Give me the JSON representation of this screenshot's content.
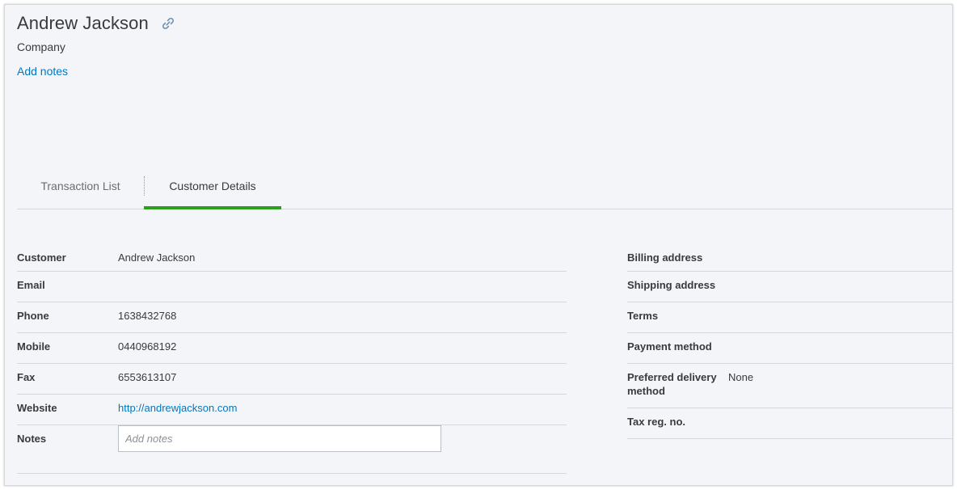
{
  "header": {
    "name": "Andrew Jackson",
    "subtitle": "Company",
    "add_notes": "Add notes",
    "link_icon": "link-icon"
  },
  "tabs": [
    {
      "label": "Transaction List",
      "active": false
    },
    {
      "label": "Customer Details",
      "active": true
    }
  ],
  "colors": {
    "accent": "#2ca01c",
    "link": "#0077c5",
    "background": "#f4f5f8"
  },
  "details_left": [
    {
      "label": "Customer",
      "value": "Andrew Jackson"
    },
    {
      "label": "Email",
      "value": ""
    },
    {
      "label": "Phone",
      "value": "1638432768"
    },
    {
      "label": "Mobile",
      "value": "0440968192"
    },
    {
      "label": "Fax",
      "value": "6553613107"
    },
    {
      "label": "Website",
      "value": "http://andrewjackson.com"
    },
    {
      "label": "Notes",
      "placeholder": "Add notes"
    }
  ],
  "details_right": [
    {
      "label": "Billing address",
      "value": ""
    },
    {
      "label": "Shipping address",
      "value": ""
    },
    {
      "label": "Terms",
      "value": ""
    },
    {
      "label": "Payment method",
      "value": ""
    },
    {
      "label": "Preferred delivery method",
      "value": "None"
    },
    {
      "label": "Tax reg. no.",
      "value": ""
    }
  ]
}
